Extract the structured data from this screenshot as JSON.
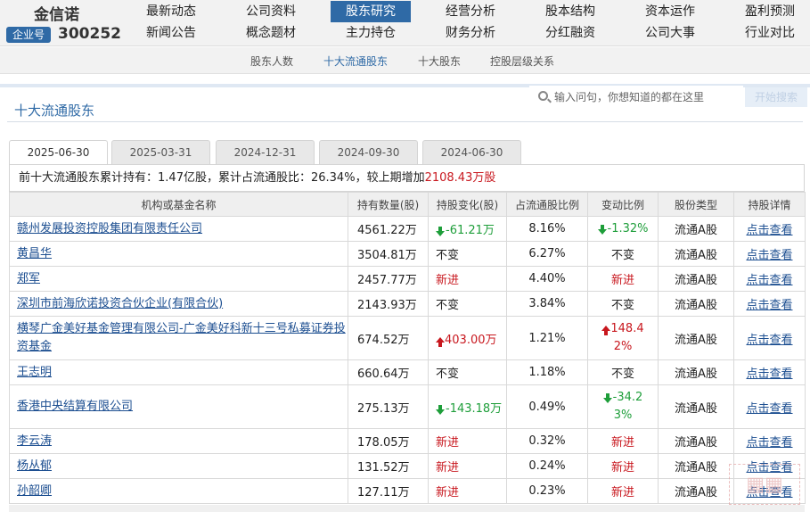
{
  "brand": {
    "name": "金信诺",
    "tag": "企业号",
    "code": "300252"
  },
  "nav": {
    "row1": [
      "最新动态",
      "公司资料",
      "股东研究",
      "经营分析",
      "股本结构",
      "资本运作",
      "盈利预测"
    ],
    "row2": [
      "新闻公告",
      "概念题材",
      "主力持仓",
      "财务分析",
      "分红融资",
      "公司大事",
      "行业对比"
    ],
    "active": "股东研究"
  },
  "subnav": {
    "items": [
      "股东人数",
      "十大流通股东",
      "十大股东",
      "控股层级关系"
    ],
    "active": "十大流通股东"
  },
  "section": {
    "title": "十大流通股东"
  },
  "search": {
    "placeholder": "输入问句，你想知道的都在这里",
    "button": "开始搜索"
  },
  "tabs": [
    "2025-06-30",
    "2025-03-31",
    "2024-12-31",
    "2024-09-30",
    "2024-06-30"
  ],
  "summary": {
    "prefix": "前十大流通股东累计持有：",
    "hold": "1.47亿股",
    "mid": "，累计占流通股比：",
    "ratio": "26.34%",
    "mid2": "，较上期增加",
    "increase": "2108.43万股"
  },
  "table": {
    "headers": [
      "机构或基金名称",
      "持有数量(股)",
      "持股变化(股)",
      "占流通股比例",
      "变动比例",
      "股份类型",
      "持股详情"
    ],
    "rows": [
      {
        "name": "赣州发展投资控股集团有限责任公司",
        "qty": "4561.22万",
        "chg": "-61.21万",
        "chg_dir": "down",
        "pct": "8.16%",
        "var": "-1.32%",
        "var_dir": "down",
        "type": "流通A股",
        "detail": "点击查看"
      },
      {
        "name": "黄昌华",
        "qty": "3504.81万",
        "chg": "不变",
        "chg_dir": "none",
        "pct": "6.27%",
        "var": "不变",
        "var_dir": "none",
        "type": "流通A股",
        "detail": "点击查看"
      },
      {
        "name": "郑军",
        "qty": "2457.77万",
        "chg": "新进",
        "chg_dir": "new",
        "pct": "4.40%",
        "var": "新进",
        "var_dir": "new",
        "type": "流通A股",
        "detail": "点击查看"
      },
      {
        "name": "深圳市前海欣诺投资合伙企业(有限合伙)",
        "qty": "2143.93万",
        "chg": "不变",
        "chg_dir": "none",
        "pct": "3.84%",
        "var": "不变",
        "var_dir": "none",
        "type": "流通A股",
        "detail": "点击查看"
      },
      {
        "name": "横琴广金美好基金管理有限公司-广金美好科新十三号私募证券投资基金",
        "qty": "674.52万",
        "chg": "403.00万",
        "chg_dir": "up",
        "pct": "1.21%",
        "var": "148.42%",
        "var_dir": "up",
        "type": "流通A股",
        "detail": "点击查看"
      },
      {
        "name": "王志明",
        "qty": "660.64万",
        "chg": "不变",
        "chg_dir": "none",
        "pct": "1.18%",
        "var": "不变",
        "var_dir": "none",
        "type": "流通A股",
        "detail": "点击查看"
      },
      {
        "name": "香港中央结算有限公司",
        "qty": "275.13万",
        "chg": "-143.18万",
        "chg_dir": "down",
        "pct": "0.49%",
        "var": "-34.23%",
        "var_dir": "down",
        "type": "流通A股",
        "detail": "点击查看"
      },
      {
        "name": "李云涛",
        "qty": "178.05万",
        "chg": "新进",
        "chg_dir": "new",
        "pct": "0.32%",
        "var": "新进",
        "var_dir": "new",
        "type": "流通A股",
        "detail": "点击查看"
      },
      {
        "name": "杨丛郁",
        "qty": "131.52万",
        "chg": "新进",
        "chg_dir": "new",
        "pct": "0.24%",
        "var": "新进",
        "var_dir": "new",
        "type": "流通A股",
        "detail": "点击查看"
      },
      {
        "name": "孙韶卿",
        "qty": "127.11万",
        "chg": "新进",
        "chg_dir": "new",
        "pct": "0.23%",
        "var": "新进",
        "var_dir": "new",
        "type": "流通A股",
        "detail": "点击查看"
      }
    ]
  },
  "colors": {
    "accent": "#2f6aa6",
    "up": "#c8171e",
    "down": "#1e9e3a",
    "link": "#1d4f91"
  }
}
